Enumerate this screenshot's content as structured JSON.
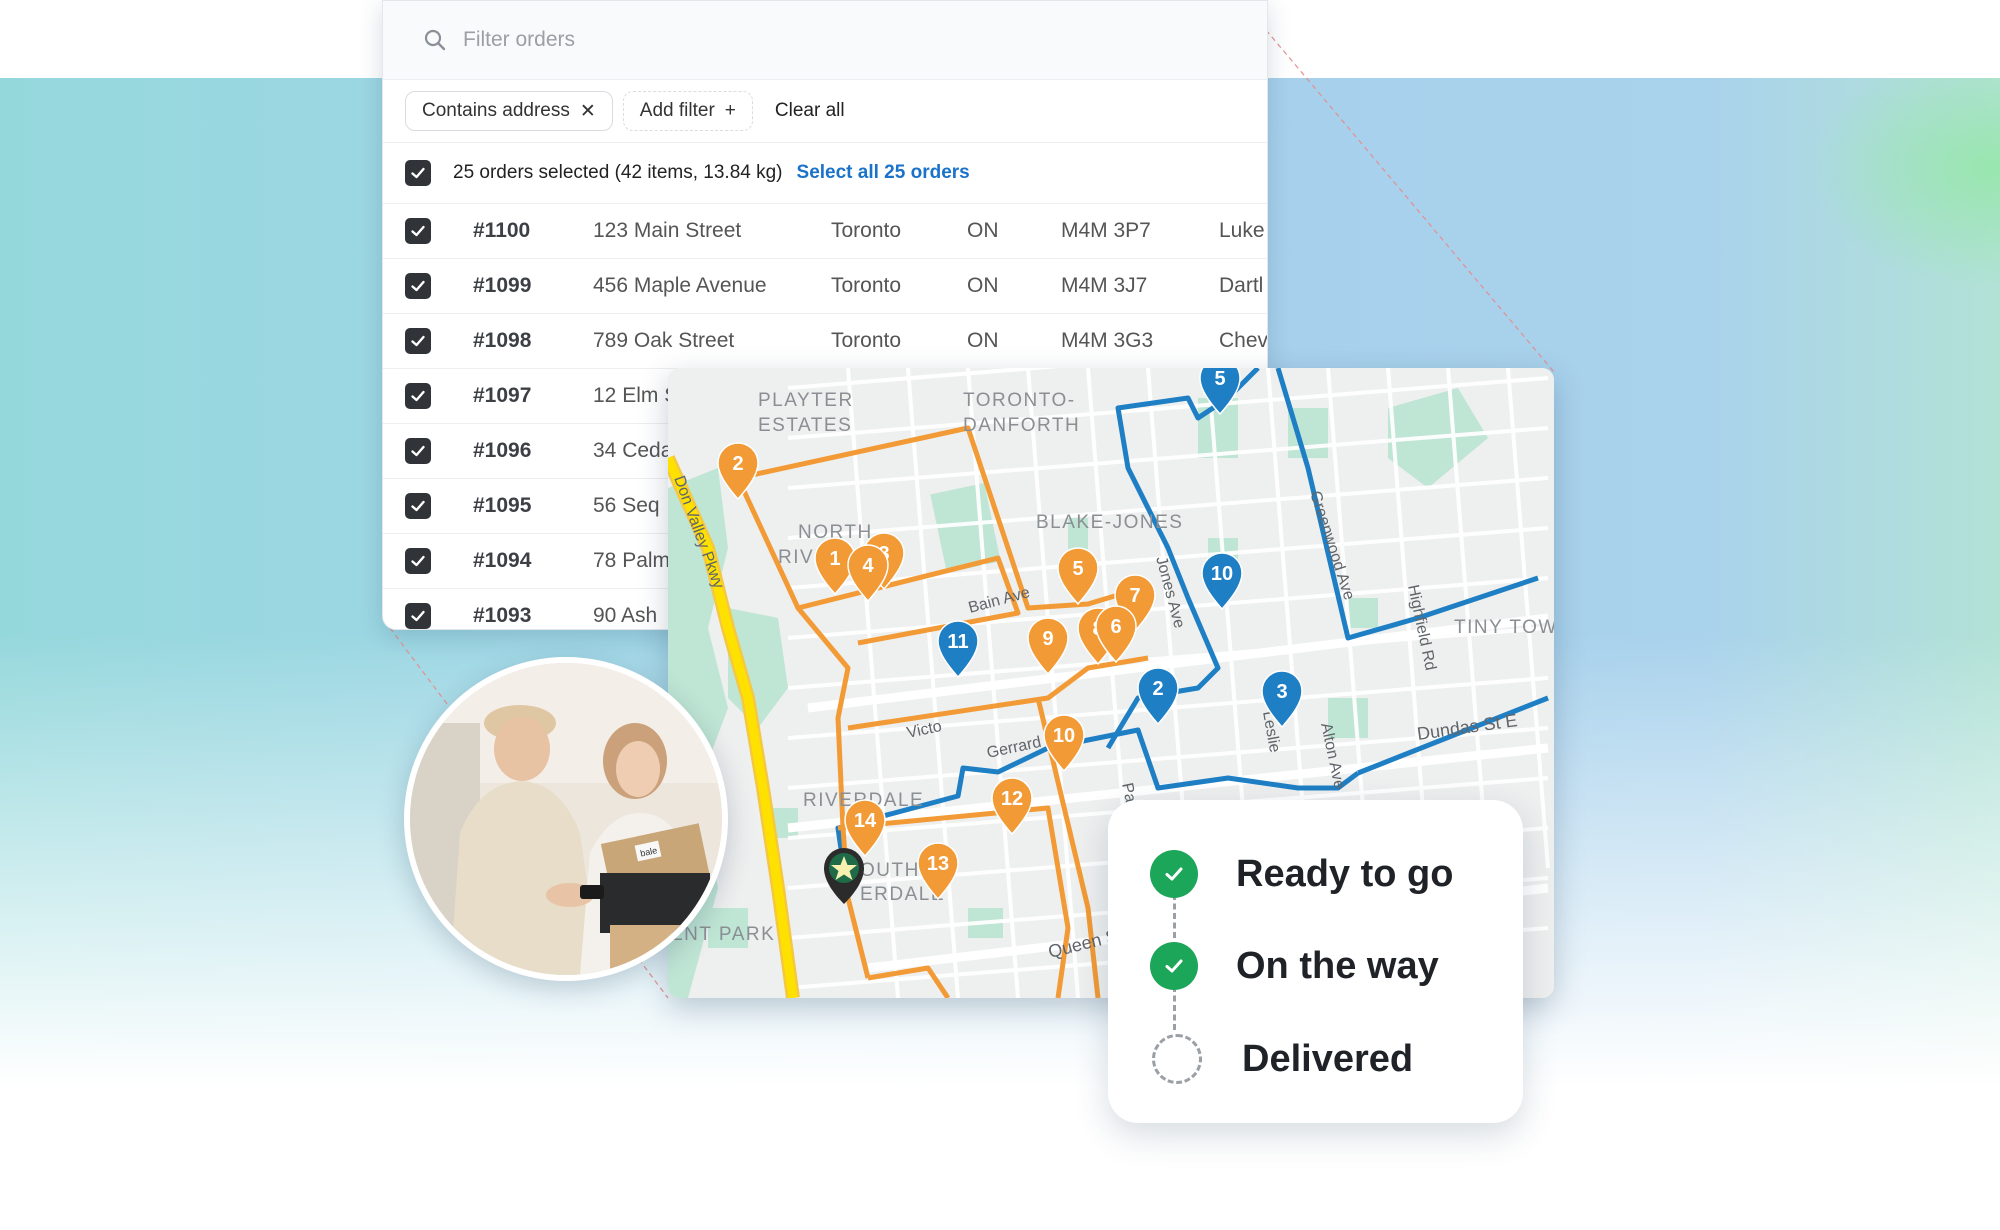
{
  "orders": {
    "search": {
      "placeholder": "Filter orders"
    },
    "filters": {
      "active_chip": "Contains address",
      "add_filter": "Add filter",
      "clear_all": "Clear all"
    },
    "selection": {
      "summary": "25 orders selected (42 items, 13.84 kg)",
      "select_all": "Select all 25 orders"
    },
    "rows": [
      {
        "id": "#1100",
        "address": "123 Main Street",
        "city": "Toronto",
        "province": "ON",
        "postal": "M4M 3P7",
        "name": "Luke"
      },
      {
        "id": "#1099",
        "address": "456 Maple Avenue",
        "city": "Toronto",
        "province": "ON",
        "postal": "M4M 3J7",
        "name": "Dartl"
      },
      {
        "id": "#1098",
        "address": "789 Oak Street",
        "city": "Toronto",
        "province": "ON",
        "postal": "M4M 3G3",
        "name": "Chev"
      },
      {
        "id": "#1097",
        "address": "12 Elm S"
      },
      {
        "id": "#1096",
        "address": "34 Ceda"
      },
      {
        "id": "#1095",
        "address": "56 Seq"
      },
      {
        "id": "#1094",
        "address": "78 Palm"
      },
      {
        "id": "#1093",
        "address": "90 Ash"
      }
    ]
  },
  "map": {
    "labels": {
      "playter": "PLAYTER",
      "estates": "ESTATES",
      "toronto": "TORONTO-",
      "danforth": "DANFORTH",
      "north": "NORTH",
      "riverdale": "RIVERDALE",
      "blake_jones": "BLAKE-JONES",
      "riverdale_south": "RIVERDALE",
      "south_part": "OUTH",
      "south_riverdale": "ERDALE",
      "ent_park": "ENT PARK",
      "tiny_town": "TINY TOW",
      "don_valley": "Don Valley Pkwy",
      "bain": "Bain Ave",
      "jones": "Jones Ave",
      "greenwood": "Greenwood Ave",
      "highfield": "Highfield Rd",
      "dundas": "Dundas St E",
      "gerrard": "Gerrard St E",
      "victoria": "Victo",
      "queen": "Queen St E",
      "leslie": "Leslie",
      "alton": "Alton Ave",
      "pape": "Pa"
    },
    "orange_pins": [
      "2",
      "1",
      "3",
      "4",
      "5",
      "7",
      "8",
      "6",
      "9",
      "10",
      "12",
      "14",
      "13"
    ],
    "blue_pins": [
      "10",
      "11",
      "2",
      "3",
      "5"
    ],
    "colors": {
      "orange_route": "#f29a35",
      "blue_route": "#1f7fc4",
      "highway": "#ffe100"
    }
  },
  "status": {
    "steps": [
      {
        "label": "Ready to go",
        "state": "done"
      },
      {
        "label": "On the way",
        "state": "done"
      },
      {
        "label": "Delivered",
        "state": "pending"
      }
    ],
    "colors": {
      "done": "#1ca65a",
      "pending": "#9aa0a6"
    }
  },
  "photo": {
    "box_text": "bale"
  }
}
